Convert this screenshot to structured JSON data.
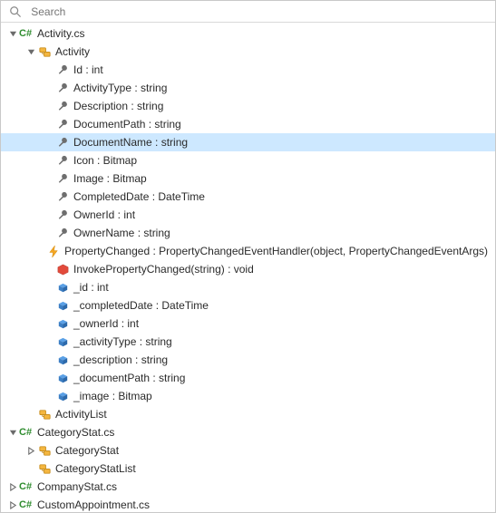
{
  "search": {
    "placeholder": "Search"
  },
  "icons": {
    "cs_badge": "C#"
  },
  "tree": {
    "rows": [
      {
        "depth": 0,
        "arrow": "down",
        "icon": "cs",
        "label": "Activity.cs",
        "interact": true,
        "selected": false
      },
      {
        "depth": 1,
        "arrow": "down",
        "icon": "class",
        "label": "Activity",
        "interact": true,
        "selected": false
      },
      {
        "depth": 2,
        "arrow": "",
        "icon": "wrench",
        "label": "Id : int",
        "interact": true,
        "selected": false
      },
      {
        "depth": 2,
        "arrow": "",
        "icon": "wrench",
        "label": "ActivityType : string",
        "interact": true,
        "selected": false
      },
      {
        "depth": 2,
        "arrow": "",
        "icon": "wrench",
        "label": "Description : string",
        "interact": true,
        "selected": false
      },
      {
        "depth": 2,
        "arrow": "",
        "icon": "wrench",
        "label": "DocumentPath : string",
        "interact": true,
        "selected": false
      },
      {
        "depth": 2,
        "arrow": "",
        "icon": "wrench",
        "label": "DocumentName : string",
        "interact": true,
        "selected": true
      },
      {
        "depth": 2,
        "arrow": "",
        "icon": "wrench",
        "label": "Icon : Bitmap",
        "interact": true,
        "selected": false
      },
      {
        "depth": 2,
        "arrow": "",
        "icon": "wrench",
        "label": "Image : Bitmap",
        "interact": true,
        "selected": false
      },
      {
        "depth": 2,
        "arrow": "",
        "icon": "wrench",
        "label": "CompletedDate : DateTime",
        "interact": true,
        "selected": false
      },
      {
        "depth": 2,
        "arrow": "",
        "icon": "wrench",
        "label": "OwnerId : int",
        "interact": true,
        "selected": false
      },
      {
        "depth": 2,
        "arrow": "",
        "icon": "wrench",
        "label": "OwnerName : string",
        "interact": true,
        "selected": false
      },
      {
        "depth": 2,
        "arrow": "",
        "icon": "event",
        "label": "PropertyChanged : PropertyChangedEventHandler(object, PropertyChangedEventArgs)",
        "interact": true,
        "selected": false
      },
      {
        "depth": 2,
        "arrow": "",
        "icon": "method",
        "label": "InvokePropertyChanged(string) : void",
        "interact": true,
        "selected": false
      },
      {
        "depth": 2,
        "arrow": "",
        "icon": "field",
        "label": "_id : int",
        "interact": true,
        "selected": false
      },
      {
        "depth": 2,
        "arrow": "",
        "icon": "field",
        "label": "_completedDate : DateTime",
        "interact": true,
        "selected": false
      },
      {
        "depth": 2,
        "arrow": "",
        "icon": "field",
        "label": "_ownerId : int",
        "interact": true,
        "selected": false
      },
      {
        "depth": 2,
        "arrow": "",
        "icon": "field",
        "label": "_activityType : string",
        "interact": true,
        "selected": false
      },
      {
        "depth": 2,
        "arrow": "",
        "icon": "field",
        "label": "_description : string",
        "interact": true,
        "selected": false
      },
      {
        "depth": 2,
        "arrow": "",
        "icon": "field",
        "label": "_documentPath : string",
        "interact": true,
        "selected": false
      },
      {
        "depth": 2,
        "arrow": "",
        "icon": "field",
        "label": "_image : Bitmap",
        "interact": true,
        "selected": false
      },
      {
        "depth": 1,
        "arrow": "",
        "icon": "class",
        "label": "ActivityList",
        "interact": true,
        "selected": false
      },
      {
        "depth": 0,
        "arrow": "down",
        "icon": "cs",
        "label": "CategoryStat.cs",
        "interact": true,
        "selected": false
      },
      {
        "depth": 1,
        "arrow": "right",
        "icon": "class",
        "label": "CategoryStat",
        "interact": true,
        "selected": false
      },
      {
        "depth": 1,
        "arrow": "",
        "icon": "class",
        "label": "CategoryStatList",
        "interact": true,
        "selected": false
      },
      {
        "depth": 0,
        "arrow": "right",
        "icon": "cs",
        "label": "CompanyStat.cs",
        "interact": true,
        "selected": false
      },
      {
        "depth": 0,
        "arrow": "right",
        "icon": "cs",
        "label": "CustomAppointment.cs",
        "interact": true,
        "selected": false
      }
    ]
  }
}
